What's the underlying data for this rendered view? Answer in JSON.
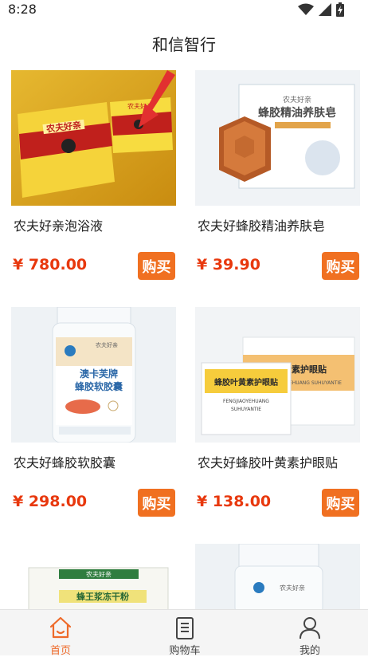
{
  "status_bar": {
    "time": "8:28"
  },
  "header": {
    "title": "和信智行"
  },
  "products": [
    {
      "name": "农夫好亲泡浴液",
      "price": "¥ 780.00",
      "buy_label": "购买",
      "image_icon": "yellow-gift-box-with-red-arrow"
    },
    {
      "name": "农夫好蜂胶精油养肤皂",
      "price": "¥ 39.90",
      "buy_label": "购买",
      "image_icon": "amber-soap-with-box"
    },
    {
      "name": "农夫好蜂胶软胶囊",
      "price": "¥ 298.00",
      "buy_label": "购买",
      "image_icon": "white-supplement-bottle"
    },
    {
      "name": "农夫好蜂胶叶黄素护眼贴",
      "price": "¥ 138.00",
      "buy_label": "购买",
      "image_icon": "eye-patch-packets"
    },
    {
      "name": "",
      "price": "",
      "buy_label": "",
      "image_icon": "royal-jelly-powder-box"
    },
    {
      "name": "",
      "price": "",
      "buy_label": "",
      "image_icon": "white-supplement-bottle"
    }
  ],
  "product_images_text": {
    "box_brand": "农夫好亲",
    "soap_title": "蜂胶精油养肤皂",
    "capsule_brand": "澳卡芙牌",
    "capsule_title": "蜂胶软胶囊",
    "patch_title": "蜂胶叶黄素护眼贴",
    "patch_title_back": "叶黄素护眼贴",
    "patch_pinyin": "FENGJIAOYEHUANG",
    "patch_pinyin2": "SUHUYANTIE",
    "powder_brand": "农夫好亲",
    "powder_title": "蜂王浆冻干粉",
    "bottle_brand": "农夫好亲"
  },
  "tab_bar": {
    "tabs": [
      {
        "label": "首页",
        "icon": "home-icon",
        "active": true
      },
      {
        "label": "购物车",
        "icon": "cart-list-icon",
        "active": false
      },
      {
        "label": "我的",
        "icon": "user-icon",
        "active": false
      }
    ]
  },
  "colors": {
    "price": "#e8380d",
    "buy_button": "#f07021",
    "active_tab": "#ee6a2a"
  }
}
